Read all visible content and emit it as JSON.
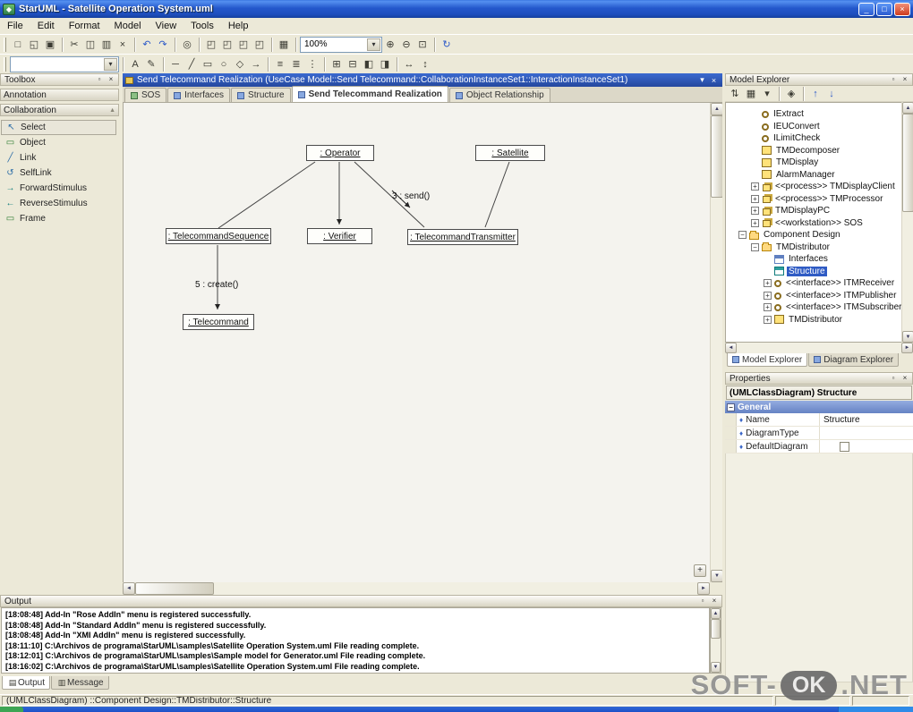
{
  "window": {
    "title": "StarUML - Satellite Operation System.uml",
    "controls": {
      "minimize": "_",
      "maximize": "□",
      "close": "×"
    }
  },
  "menubar": {
    "items": [
      "File",
      "Edit",
      "Format",
      "Model",
      "View",
      "Tools",
      "Help"
    ]
  },
  "toolbar": {
    "zoom_value": "100%",
    "style_combo_value": ""
  },
  "icons": {
    "app": "◆",
    "new": "□",
    "open": "◱",
    "save": "▣",
    "print": "▤",
    "cut": "✂",
    "copy": "◫",
    "paste": "▥",
    "delete": "×",
    "undo": "↶",
    "redo": "↷",
    "find": "◎",
    "window": "◰",
    "grid": "▦",
    "zoom_in": "⊕",
    "zoom_out": "⊖",
    "zoom_fit": "⊡",
    "refresh": "↻",
    "dropdown": "▾",
    "text": "A",
    "pen": "✎",
    "line": "─",
    "diag_line": "╱",
    "rect": "▭",
    "ellipse": "○",
    "diamond_shape": "◇",
    "arrow_right": "→",
    "align_left": "≡",
    "align_center": "≣",
    "align_v": "⋮",
    "group": "⊞",
    "ungroup": "⊟",
    "bring_front": "◧",
    "send_back": "◨",
    "flip_h": "↔",
    "flip_v": "↕",
    "sort": "⇅",
    "view_mode": "▦",
    "stereotype": "◈",
    "move_up": "↑",
    "move_down": "↓",
    "pin": "▫",
    "close": "×",
    "scroll_up": "▲",
    "scroll_down": "▼",
    "scroll_left": "◄",
    "scroll_right": "►",
    "plus": "+",
    "cursor": "↖",
    "object_shape": "▭",
    "link_line": "╱",
    "self_link": "↺",
    "forward": "→",
    "reverse": "←",
    "frame_shape": "▭",
    "diamond": "♦",
    "tab_doc": "▤",
    "tab_msg": "▥"
  },
  "toolbox": {
    "title": "Toolbox",
    "groups": [
      "Annotation",
      "Collaboration"
    ],
    "items": [
      "Select",
      "Object",
      "Link",
      "SelfLink",
      "ForwardStimulus",
      "ReverseStimulus",
      "Frame"
    ],
    "selected_item": "Select"
  },
  "diagram": {
    "header": "Send Telecommand Realization (UseCase Model::Send Telecommand::CollaborationInstanceSet1::InteractionInstanceSet1)",
    "tabs": [
      "SOS",
      "Interfaces",
      "Structure",
      "Send Telecommand Realization",
      "Object Relationship"
    ],
    "active_tab": "Send Telecommand Realization",
    "nodes": [
      ": Operator",
      ": Satellite",
      ": TelecommandSequence",
      ": Verifier",
      ": TelecommandTransmitter",
      ": Telecommand"
    ],
    "edge_labels": [
      "3 : send()",
      "5 : create()"
    ],
    "edges": [
      {
        "from": ": Operator",
        "to": ": TelecommandSequence"
      },
      {
        "from": ": Operator",
        "to": ": Verifier",
        "arrow": true
      },
      {
        "from": ": Operator",
        "to": ": TelecommandTransmitter",
        "arrow": true,
        "label": "3 : send()"
      },
      {
        "from": ": Satellite",
        "to": ": TelecommandTransmitter"
      },
      {
        "from": ": TelecommandSequence",
        "to": ": Telecommand",
        "arrow": true,
        "label": "5 : create()"
      }
    ]
  },
  "model_explorer": {
    "title": "Model Explorer",
    "items": [
      "IExtract",
      "IEUConvert",
      "ILimitCheck",
      "TMDecomposer",
      "TMDisplay",
      "AlarmManager",
      "<<process>> TMDisplayClient",
      "<<process>> TMProcessor",
      "TMDisplayPC",
      "<<workstation>> SOS",
      "Component Design",
      "TMDistributor",
      "Interfaces",
      "Structure",
      "<<interface>> ITMReceiver",
      "<<interface>> ITMPublisher",
      "<<interface>> ITMSubscriber",
      "TMDistributor"
    ],
    "selected_item": "Structure",
    "tabs": [
      "Model Explorer",
      "Diagram Explorer"
    ]
  },
  "properties": {
    "title": "Properties",
    "object": "(UMLClassDiagram) Structure",
    "section": "General",
    "rows": [
      {
        "name": "Name",
        "value": "Structure"
      },
      {
        "name": "DiagramType",
        "value": ""
      },
      {
        "name": "DefaultDiagram",
        "value": ""
      }
    ]
  },
  "output": {
    "title": "Output",
    "lines": [
      "[18:08:48] Add-In \"Rose AddIn\" menu is registered successfully.",
      "[18:08:48] Add-In \"Standard AddIn\" menu is registered successfully.",
      "[18:08:48] Add-In \"XMI AddIn\" menu is registered successfully.",
      "[18:11:10] C:\\Archivos de programa\\StarUML\\samples\\Satellite Operation System.uml File reading complete.",
      "[18:12:01] C:\\Archivos de programa\\StarUML\\samples\\Sample model for Generator.uml File reading complete.",
      "[18:16:02] C:\\Archivos de programa\\StarUML\\samples\\Satellite Operation System.uml File reading complete."
    ],
    "tabs": [
      "Output",
      "Message"
    ]
  },
  "statusbar": {
    "text": "(UMLClassDiagram) ::Component Design::TMDistributor::Structure"
  },
  "watermark": {
    "part1": "SOFT-",
    "part2": "OK",
    "part3": ".NET"
  },
  "colors": {
    "titlebar_blue": "#2A5BC8",
    "panel_bg": "#ECE9D8",
    "selection_blue": "#2F5BC4",
    "diagram_header_blue": "#2A52B0",
    "watermark_gray": "#8F8F8F"
  }
}
